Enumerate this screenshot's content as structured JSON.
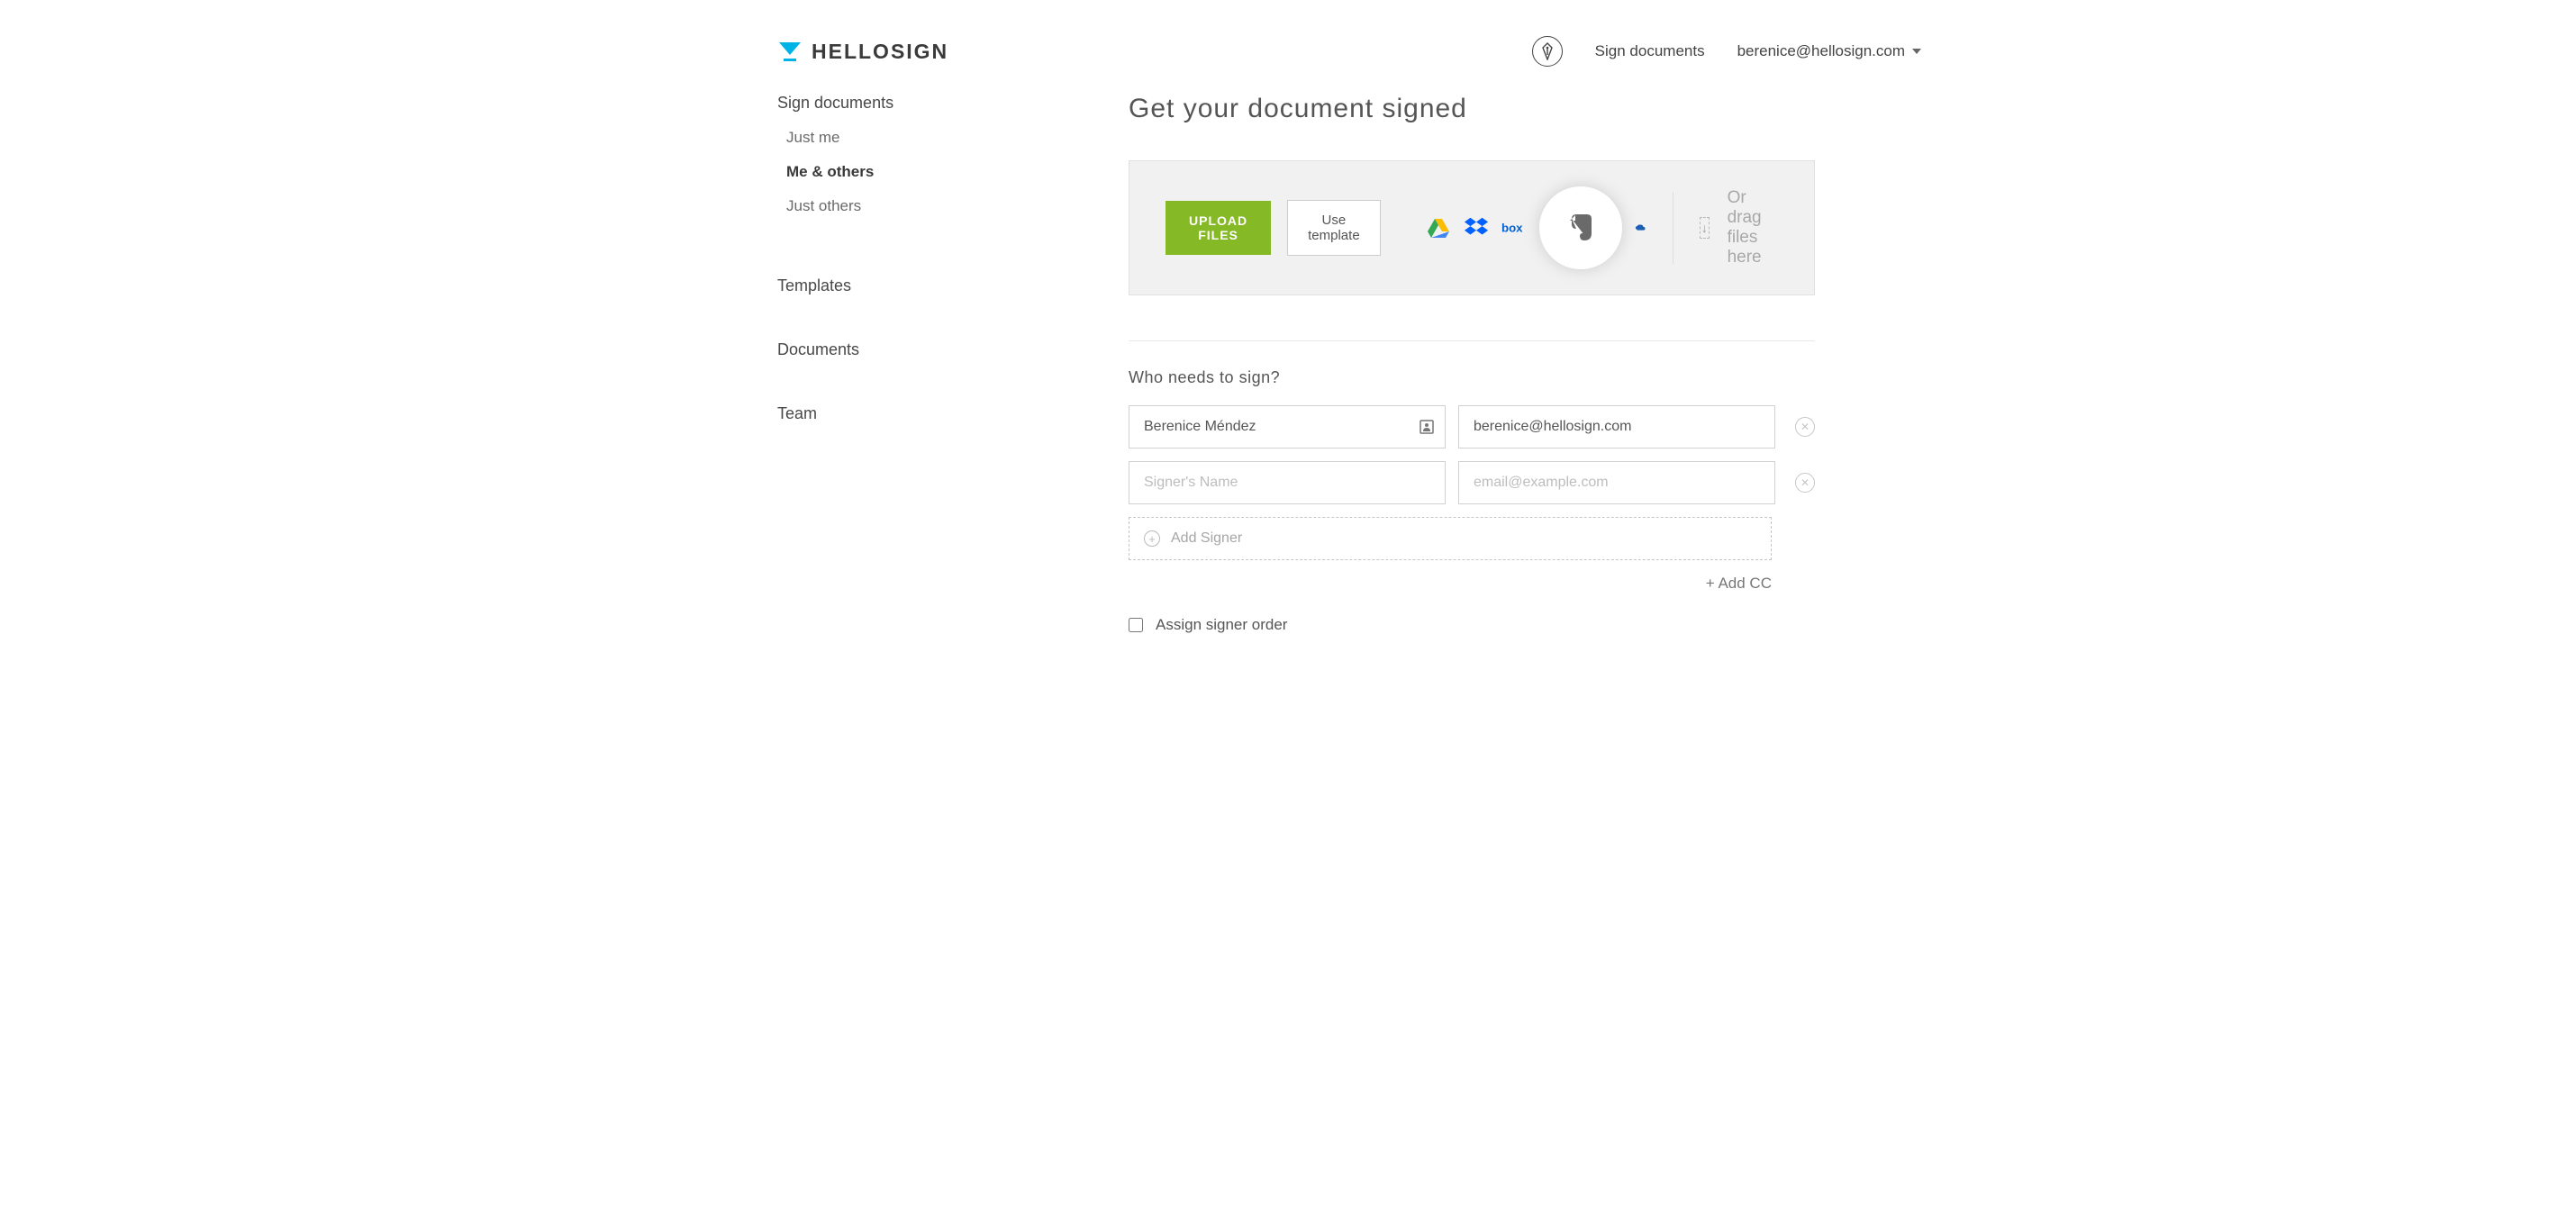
{
  "brand": {
    "name": "HELLOSIGN"
  },
  "header": {
    "sign_documents": "Sign documents",
    "user_email": "berenice@hellosign.com"
  },
  "sidebar": {
    "sign_documents": "Sign documents",
    "sub": {
      "just_me": "Just me",
      "me_others": "Me & others",
      "just_others": "Just others"
    },
    "templates": "Templates",
    "documents": "Documents",
    "team": "Team"
  },
  "main": {
    "title": "Get your document signed",
    "upload_btn": "UPLOAD FILES",
    "template_btn": "Use template",
    "drag_label": "Or drag files here",
    "section_label": "Who needs to sign?",
    "signers": [
      {
        "name": "Berenice Méndez",
        "email": "berenice@hellosign.com"
      },
      {
        "name": "",
        "email": ""
      }
    ],
    "name_placeholder": "Signer's Name",
    "email_placeholder": "email@example.com",
    "add_signer": "Add Signer",
    "add_cc": "+ Add CC",
    "assign_order": "Assign signer order"
  },
  "colors": {
    "accent_blue": "#00b3e6",
    "upload_green": "#86b926",
    "gdrive_yellow": "#fbbc05",
    "gdrive_green": "#34a853",
    "gdrive_blue": "#4285f4",
    "dropbox_blue": "#0061ff",
    "box_blue": "#0061d5",
    "evernote_gray": "#6a6a6a"
  }
}
